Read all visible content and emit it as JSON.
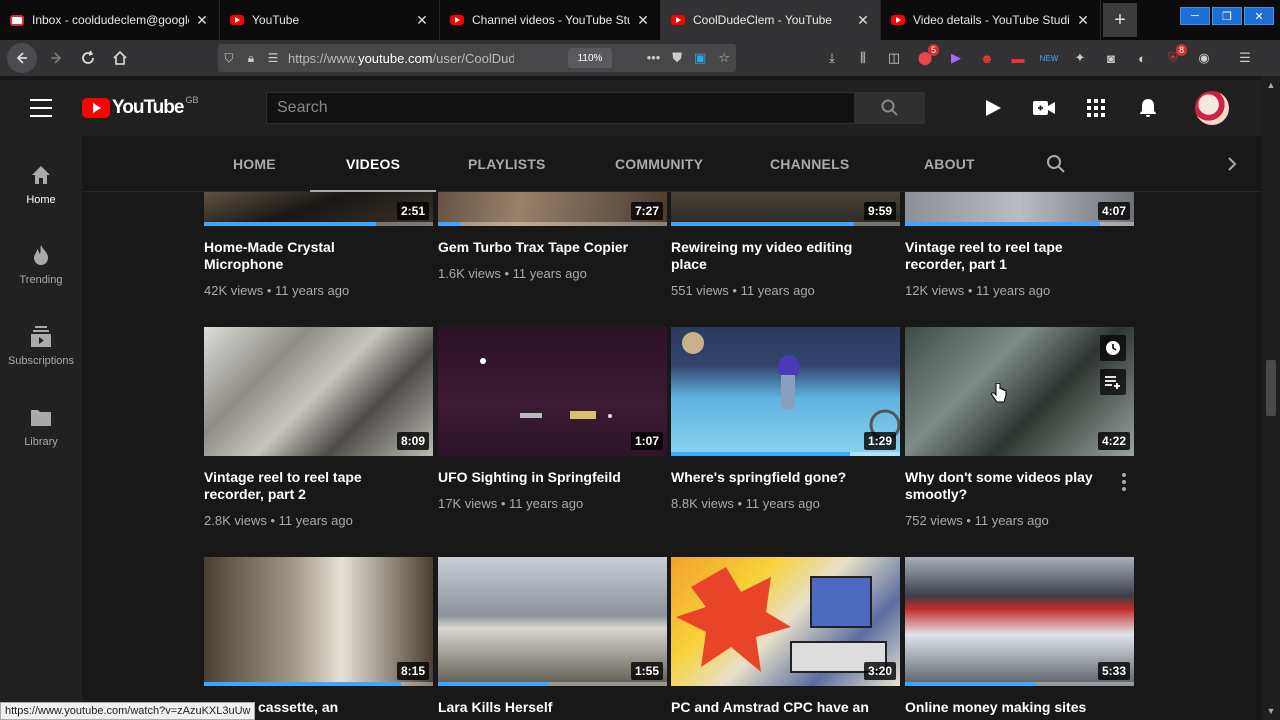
{
  "browser": {
    "tabs": [
      {
        "title": "Inbox - cooldudeclem@googlemail.com",
        "favicon": "gmail-icon",
        "active": false
      },
      {
        "title": "YouTube",
        "favicon": "youtube-icon",
        "active": false
      },
      {
        "title": "Channel videos - YouTube Studio",
        "favicon": "youtube-icon",
        "active": false
      },
      {
        "title": "CoolDudeClem - YouTube",
        "favicon": "youtube-icon",
        "active": true
      },
      {
        "title": "Video details - YouTube Studio",
        "favicon": "youtube-icon",
        "active": false
      }
    ],
    "new_tab": "+",
    "url_prefix": "https://www.",
    "url_host": "youtube.com",
    "url_path": "/user/CoolDudeClem",
    "zoom": "110%",
    "ext_badge_1": "5",
    "ext_badge_2": "8",
    "ext_new_label": "NEW"
  },
  "youtube": {
    "logo_text": "YouTube",
    "country_code": "GB",
    "search_placeholder": "Search"
  },
  "guide": [
    {
      "label": "Home",
      "icon": "home-icon"
    },
    {
      "label": "Trending",
      "icon": "flame-icon"
    },
    {
      "label": "Subscriptions",
      "icon": "subscriptions-icon"
    },
    {
      "label": "Library",
      "icon": "folder-icon"
    }
  ],
  "channel_tabs": [
    {
      "label": "HOME"
    },
    {
      "label": "VIDEOS",
      "active": true
    },
    {
      "label": "PLAYLISTS"
    },
    {
      "label": "COMMUNITY"
    },
    {
      "label": "CHANNELS"
    },
    {
      "label": "ABOUT"
    }
  ],
  "videos": [
    {
      "title": "Home-Made Crystal Microphone",
      "views": "42K views",
      "age": "11 years ago",
      "duration": "2:51",
      "watched": 0.75
    },
    {
      "title": "Gem Turbo Trax Tape Copier",
      "views": "1.6K views",
      "age": "11 years ago",
      "duration": "7:27",
      "watched": 0.1
    },
    {
      "title": "Rewireing my video editing place",
      "views": "551 views",
      "age": "11 years ago",
      "duration": "9:59",
      "watched": 0.8
    },
    {
      "title": "Vintage reel to reel tape recorder, part 1",
      "views": "12K views",
      "age": "11 years ago",
      "duration": "4:07",
      "watched": 0.85
    },
    {
      "title": "Vintage reel to reel tape recorder, part 2",
      "views": "2.8K views",
      "age": "11 years ago",
      "duration": "8:09",
      "watched": 0.0
    },
    {
      "title": "UFO Sighting in Springfeild",
      "views": "17K views",
      "age": "11 years ago",
      "duration": "1:07",
      "watched": 0.0
    },
    {
      "title": "Where's springfield gone?",
      "views": "8.8K views",
      "age": "11 years ago",
      "duration": "1:29",
      "watched": 0.78
    },
    {
      "title": "Why don't some videos play smootly?",
      "views": "752 views",
      "age": "11 years ago",
      "duration": "4:22",
      "watched": 0.0
    },
    {
      "title": "cassette, an",
      "views": "",
      "age": "",
      "duration": "8:15",
      "watched": 0.86
    },
    {
      "title": "Lara Kills Herself",
      "views": "",
      "age": "",
      "duration": "1:55",
      "watched": 0.48
    },
    {
      "title": "PC and Amstrad CPC have an",
      "views": "",
      "age": "",
      "duration": "3:20",
      "watched": 0.0
    },
    {
      "title": "Online money making sites",
      "views": "",
      "age": "",
      "duration": "5:33",
      "watched": 0.57
    }
  ],
  "meta_separator": " • ",
  "status_url": "https://www.youtube.com/watch?v=zAzuKXL3uUw"
}
